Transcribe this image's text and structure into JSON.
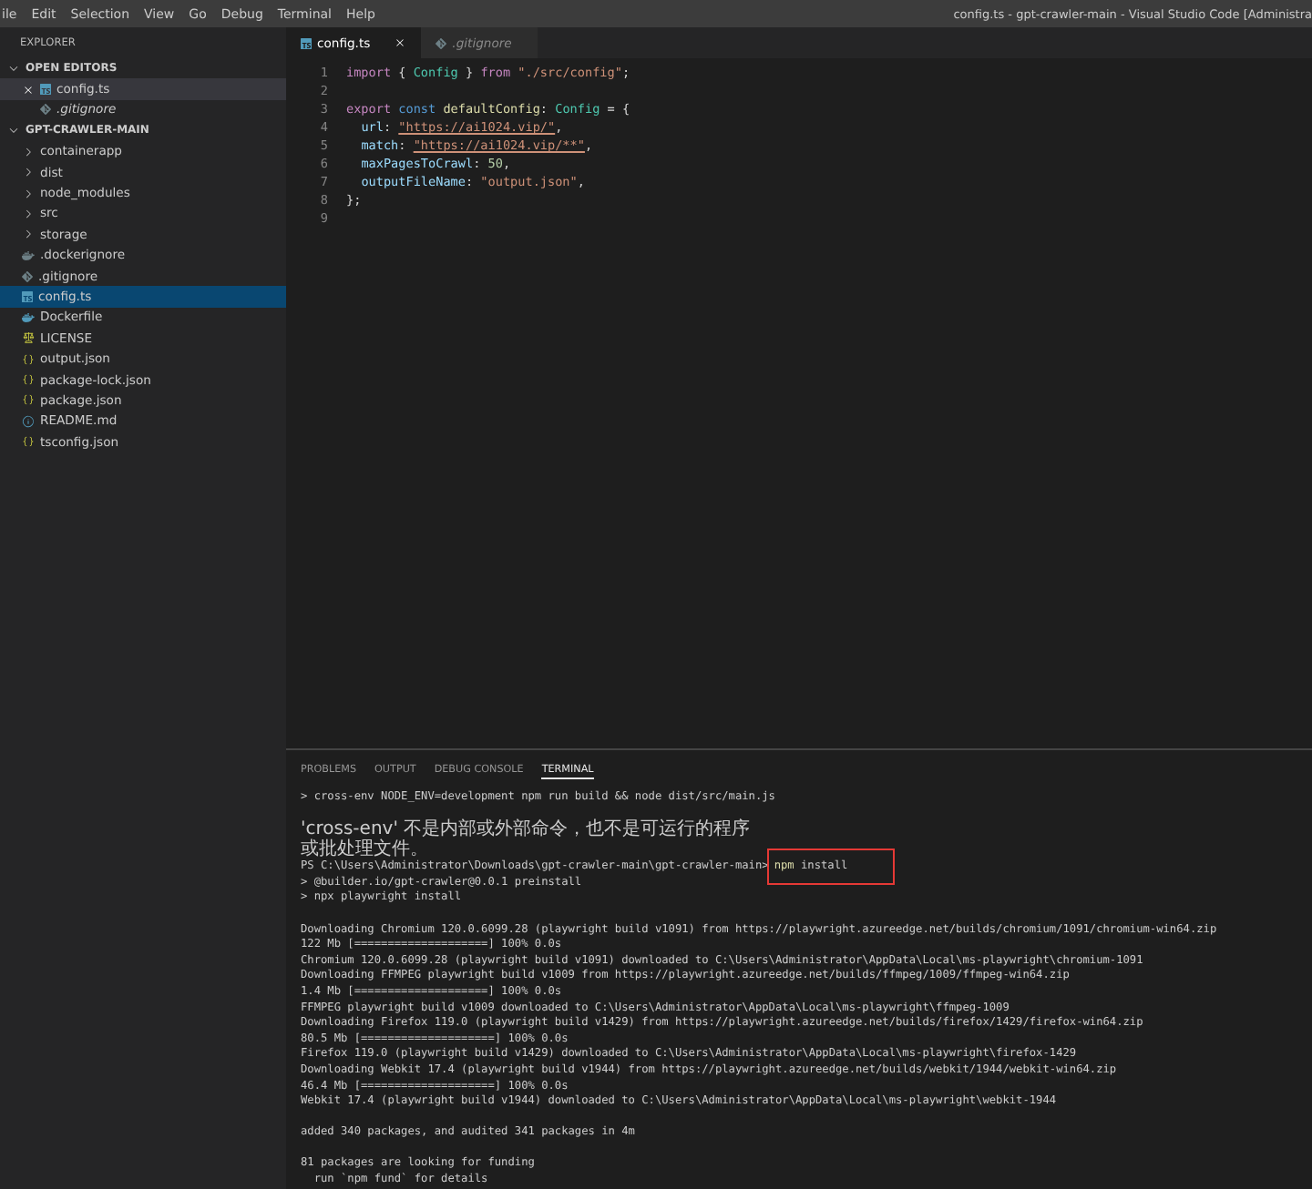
{
  "title_bar": {
    "menu": [
      "ile",
      "Edit",
      "Selection",
      "View",
      "Go",
      "Debug",
      "Terminal",
      "Help"
    ],
    "title": "config.ts - gpt-crawler-main - Visual Studio Code [Administra"
  },
  "sidebar": {
    "title": "EXPLORER",
    "open_editors": {
      "label": "OPEN EDITORS",
      "expanded": true,
      "items": [
        {
          "name": "config.ts",
          "kind": "ts",
          "active": true,
          "preview": false
        },
        {
          "name": ".gitignore",
          "kind": "git",
          "active": false,
          "preview": true
        }
      ]
    },
    "folder": {
      "label": "GPT-CRAWLER-MAIN",
      "expanded": true,
      "items": [
        {
          "name": "containerapp",
          "kind": "folder",
          "expanded": false,
          "selected": false
        },
        {
          "name": "dist",
          "kind": "folder",
          "expanded": false,
          "selected": false
        },
        {
          "name": "node_modules",
          "kind": "folder",
          "expanded": false,
          "selected": false
        },
        {
          "name": "src",
          "kind": "folder",
          "expanded": false,
          "selected": false
        },
        {
          "name": "storage",
          "kind": "folder",
          "expanded": false,
          "selected": false
        },
        {
          "name": ".dockerignore",
          "kind": "docker-muted",
          "selected": false
        },
        {
          "name": ".gitignore",
          "kind": "git",
          "selected": false
        },
        {
          "name": "config.ts",
          "kind": "ts",
          "selected": true
        },
        {
          "name": "Dockerfile",
          "kind": "docker",
          "selected": false
        },
        {
          "name": "LICENSE",
          "kind": "license",
          "selected": false
        },
        {
          "name": "output.json",
          "kind": "json",
          "selected": false
        },
        {
          "name": "package-lock.json",
          "kind": "json",
          "selected": false
        },
        {
          "name": "package.json",
          "kind": "json",
          "selected": false
        },
        {
          "name": "README.md",
          "kind": "info",
          "selected": false
        },
        {
          "name": "tsconfig.json",
          "kind": "json",
          "selected": false
        }
      ]
    }
  },
  "editor": {
    "tabs": [
      {
        "label": "config.ts",
        "kind": "ts",
        "selected": true,
        "preview": false
      },
      {
        "label": ".gitignore",
        "kind": "git",
        "selected": false,
        "preview": true
      }
    ],
    "lines": [
      {
        "number": "1",
        "tokens": [
          {
            "kind": "keyword",
            "text": "import"
          },
          {
            "kind": "plain",
            "text": " { "
          },
          {
            "kind": "type",
            "text": "Config"
          },
          {
            "kind": "plain",
            "text": " } "
          },
          {
            "kind": "keyword",
            "text": "from"
          },
          {
            "kind": "string",
            "text": " \"./src/config\""
          },
          {
            "kind": "plain",
            "text": ";"
          }
        ]
      },
      {
        "number": "2"
      },
      {
        "number": "3",
        "tokens": [
          {
            "kind": "keyword",
            "text": "export"
          },
          {
            "kind": "storage",
            "text": " const"
          },
          {
            "kind": "variable",
            "text": " defaultConfig"
          },
          {
            "kind": "plain",
            "text": ": "
          },
          {
            "kind": "type",
            "text": "Config"
          },
          {
            "kind": "plain",
            "text": " = {"
          }
        ]
      },
      {
        "number": "4",
        "indented": true,
        "tokens": [
          {
            "kind": "property",
            "text": "url"
          },
          {
            "kind": "plain",
            "text": ": "
          },
          {
            "kind": "link",
            "text": "\"https://ai1024.vip/\""
          },
          {
            "kind": "plain",
            "text": ","
          }
        ]
      },
      {
        "number": "5",
        "indented": true,
        "tokens": [
          {
            "kind": "property",
            "text": "match"
          },
          {
            "kind": "plain",
            "text": ": "
          },
          {
            "kind": "link",
            "text": "\"https://ai1024.vip/**\""
          },
          {
            "kind": "plain",
            "text": ","
          }
        ]
      },
      {
        "number": "6",
        "indented": true,
        "tokens": [
          {
            "kind": "property",
            "text": "maxPagesToCrawl"
          },
          {
            "kind": "plain",
            "text": ": "
          },
          {
            "kind": "number",
            "text": "50"
          },
          {
            "kind": "plain",
            "text": ","
          }
        ]
      },
      {
        "number": "7",
        "indented": true,
        "tokens": [
          {
            "kind": "property",
            "text": "outputFileName"
          },
          {
            "kind": "plain",
            "text": ": "
          },
          {
            "kind": "string",
            "text": "\"output.json\""
          },
          {
            "kind": "plain",
            "text": ","
          }
        ]
      },
      {
        "number": "8",
        "tokens": [
          {
            "kind": "plain",
            "text": "};"
          }
        ]
      },
      {
        "number": "9"
      }
    ]
  },
  "panel": {
    "tabs": [
      {
        "label": "PROBLEMS",
        "selected": false
      },
      {
        "label": "OUTPUT",
        "selected": false
      },
      {
        "label": "DEBUG CONSOLE",
        "selected": false
      },
      {
        "label": "TERMINAL",
        "selected": true
      }
    ],
    "terminal": [
      {
        "kind": "output",
        "text": "> cross-env NODE_ENV=development npm run build && node dist/src/main.js"
      },
      {
        "kind": "blank"
      },
      {
        "kind": "output",
        "text": "'cross-env' 不是内部或外部命令，也不是可运行的程序"
      },
      {
        "kind": "output",
        "text": "或批处理文件。"
      },
      {
        "kind": "prompt",
        "prompt": "PS C:\\Users\\Administrator\\Downloads\\gpt-crawler-main\\gpt-crawler-main>",
        "command": [
          "npm",
          "install"
        ],
        "highlighted": true
      },
      {
        "kind": "output",
        "text": "> @builder.io/gpt-crawler@0.0.1 preinstall"
      },
      {
        "kind": "output",
        "text": "> npx playwright install"
      },
      {
        "kind": "blank"
      },
      {
        "kind": "output",
        "text": "Downloading Chromium 120.0.6099.28 (playwright build v1091) from https://playwright.azureedge.net/builds/chromium/1091/chromium-win64.zip"
      },
      {
        "kind": "output",
        "text": "122 Mb [====================] 100% 0.0s"
      },
      {
        "kind": "output",
        "text": "Chromium 120.0.6099.28 (playwright build v1091) downloaded to C:\\Users\\Administrator\\AppData\\Local\\ms-playwright\\chromium-1091"
      },
      {
        "kind": "output",
        "text": "Downloading FFMPEG playwright build v1009 from https://playwright.azureedge.net/builds/ffmpeg/1009/ffmpeg-win64.zip"
      },
      {
        "kind": "output",
        "text": "1.4 Mb [====================] 100% 0.0s"
      },
      {
        "kind": "output",
        "text": "FFMPEG playwright build v1009 downloaded to C:\\Users\\Administrator\\AppData\\Local\\ms-playwright\\ffmpeg-1009"
      },
      {
        "kind": "output",
        "text": "Downloading Firefox 119.0 (playwright build v1429) from https://playwright.azureedge.net/builds/firefox/1429/firefox-win64.zip"
      },
      {
        "kind": "output",
        "text": "80.5 Mb [====================] 100% 0.0s"
      },
      {
        "kind": "output",
        "text": "Firefox 119.0 (playwright build v1429) downloaded to C:\\Users\\Administrator\\AppData\\Local\\ms-playwright\\firefox-1429"
      },
      {
        "kind": "output",
        "text": "Downloading Webkit 17.4 (playwright build v1944) from https://playwright.azureedge.net/builds/webkit/1944/webkit-win64.zip"
      },
      {
        "kind": "output",
        "text": "46.4 Mb [====================] 100% 0.0s"
      },
      {
        "kind": "output",
        "text": "Webkit 17.4 (playwright build v1944) downloaded to C:\\Users\\Administrator\\AppData\\Local\\ms-playwright\\webkit-1944"
      },
      {
        "kind": "blank"
      },
      {
        "kind": "output",
        "text": "added 340 packages, and audited 341 packages in 4m"
      },
      {
        "kind": "blank"
      },
      {
        "kind": "output",
        "text": "81 packages are looking for funding"
      },
      {
        "kind": "output",
        "text": "  run `npm fund` for details"
      }
    ]
  }
}
